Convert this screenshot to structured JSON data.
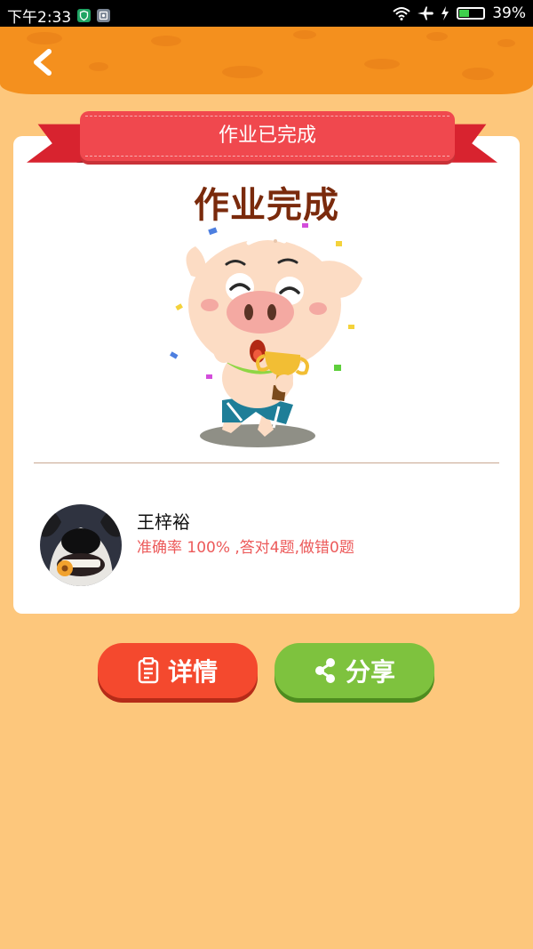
{
  "status_bar": {
    "time": "下午2:33",
    "battery": "39%",
    "battery_level": 0.39,
    "icons": [
      "shield-notification-icon",
      "app-notification-icon",
      "wifi-icon",
      "airplane-mode-icon",
      "charging-icon",
      "battery-icon"
    ]
  },
  "header": {
    "back_icon": "back-arrow-icon"
  },
  "card": {
    "ribbon_title": "作业已完成",
    "complete_heading": "作业完成"
  },
  "student": {
    "name": "王梓裕",
    "result": "准确率 100% ,答对4题,做错0题"
  },
  "actions": {
    "detail_label": "详情",
    "detail_icon": "clipboard-icon",
    "share_label": "分享",
    "share_icon": "share-icon"
  },
  "colors": {
    "background": "#FDC77C",
    "header": "#F4901E",
    "ribbon": "#F0484E",
    "heading": "#7A2A0C",
    "result_text": "#EC5A5A",
    "detail_button": "#F4492E",
    "share_button": "#7EC23E"
  }
}
